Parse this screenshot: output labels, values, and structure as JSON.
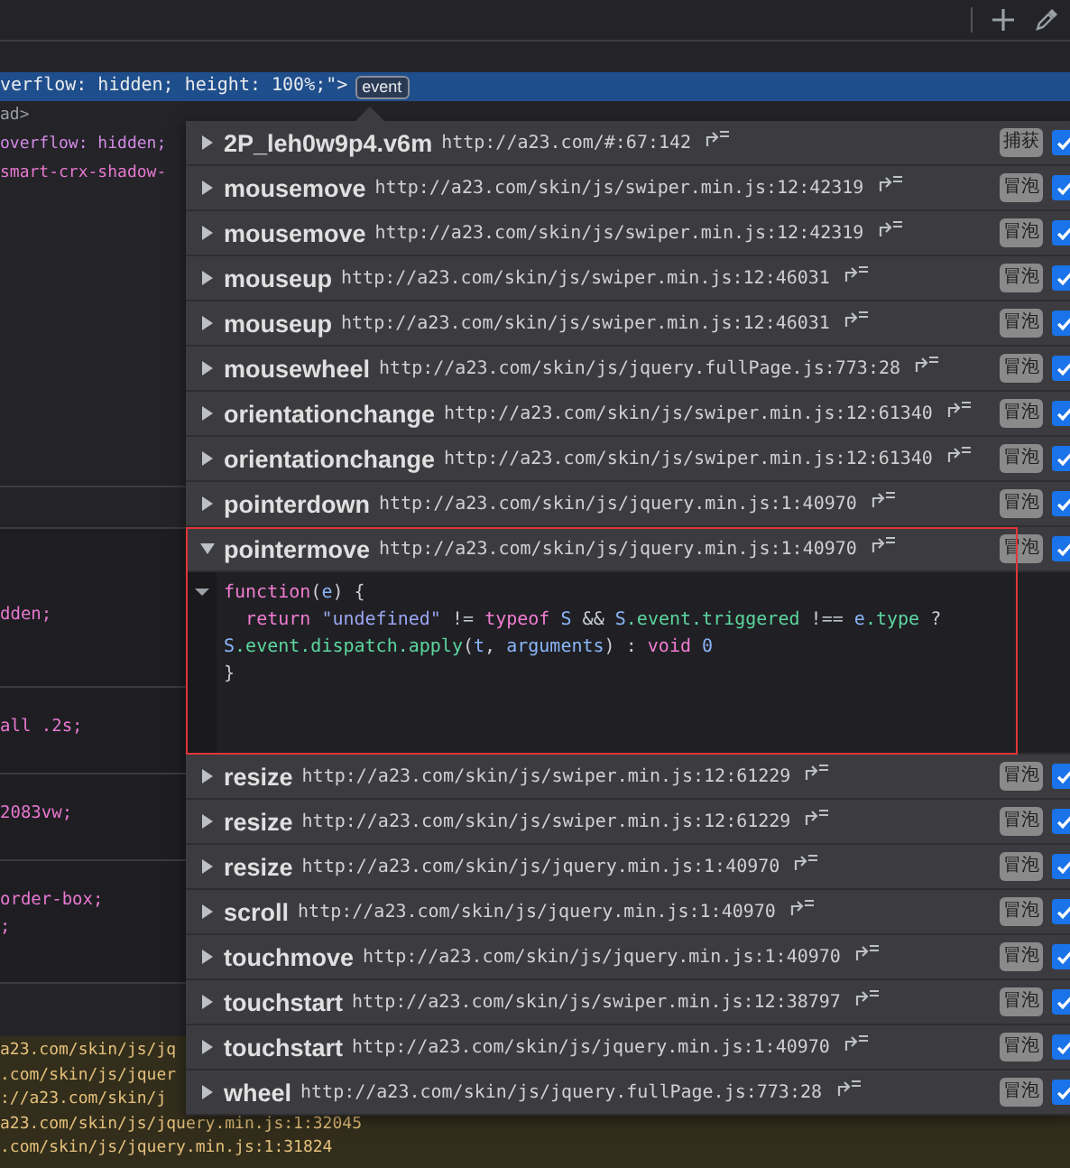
{
  "elements_panel": {
    "lines": [
      {
        "text": "verflow: hidden; height: 100%;\">",
        "selected": true,
        "badge": "event"
      },
      {
        "text": "ad>",
        "kind": "tag",
        "selected": false
      },
      {
        "text": " overflow: hidden;",
        "kind": "attribute",
        "selected": false
      },
      {
        "text": "smart-crx-shadow-",
        "kind": "value",
        "selected": false
      }
    ]
  },
  "styles_panel": {
    "rules": [
      {
        "lines": [
          "dden;"
        ]
      },
      {
        "lines": [
          "all .2s;"
        ]
      },
      {
        "lines": [
          "2083vw;"
        ]
      },
      {
        "lines": [
          "order-box;",
          ";"
        ]
      }
    ]
  },
  "console": {
    "lines": [
      "a23.com/skin/js/jq",
      ".com/skin/js/jquer",
      "://a23.com/skin/j",
      "a23.com/skin/js/jquery.min.js:1:32045",
      ".com/skin/js/jquery.min.js:1:31824"
    ]
  },
  "event_popup": {
    "listeners": [
      {
        "name": "2P_leh0w9p4.v6m",
        "url": "http://a23.com/#:67:142",
        "phase": "捕获",
        "checked": true,
        "expanded": false
      },
      {
        "name": "mousemove",
        "url": "http://a23.com/skin/js/swiper.min.js:12:42319",
        "phase": "冒泡",
        "checked": true,
        "expanded": false
      },
      {
        "name": "mousemove",
        "url": "http://a23.com/skin/js/swiper.min.js:12:42319",
        "phase": "冒泡",
        "checked": true,
        "expanded": false
      },
      {
        "name": "mouseup",
        "url": "http://a23.com/skin/js/swiper.min.js:12:46031",
        "phase": "冒泡",
        "checked": true,
        "expanded": false
      },
      {
        "name": "mouseup",
        "url": "http://a23.com/skin/js/swiper.min.js:12:46031",
        "phase": "冒泡",
        "checked": true,
        "expanded": false
      },
      {
        "name": "mousewheel",
        "url": "http://a23.com/skin/js/jquery.fullPage.js:773:28",
        "phase": "冒泡",
        "checked": true,
        "expanded": false
      },
      {
        "name": "orientationchange",
        "url": "http://a23.com/skin/js/swiper.min.js:12:61340",
        "phase": "冒泡",
        "checked": true,
        "expanded": false
      },
      {
        "name": "orientationchange",
        "url": "http://a23.com/skin/js/swiper.min.js:12:61340",
        "phase": "冒泡",
        "checked": true,
        "expanded": false
      },
      {
        "name": "pointerdown",
        "url": "http://a23.com/skin/js/jquery.min.js:1:40970",
        "phase": "冒泡",
        "checked": true,
        "expanded": false
      },
      {
        "name": "pointermove",
        "url": "http://a23.com/skin/js/jquery.min.js:1:40970",
        "phase": "冒泡",
        "checked": true,
        "expanded": true,
        "source": [
          "function(e) {",
          "  return \"undefined\" != typeof S && S.event.triggered !== e.type ?",
          "S.event.dispatch.apply(t, arguments) : void 0",
          "}"
        ]
      },
      {
        "name": "resize",
        "url": "http://a23.com/skin/js/swiper.min.js:12:61229",
        "phase": "冒泡",
        "checked": true,
        "expanded": false
      },
      {
        "name": "resize",
        "url": "http://a23.com/skin/js/swiper.min.js:12:61229",
        "phase": "冒泡",
        "checked": true,
        "expanded": false
      },
      {
        "name": "resize",
        "url": "http://a23.com/skin/js/jquery.min.js:1:40970",
        "phase": "冒泡",
        "checked": true,
        "expanded": false
      },
      {
        "name": "scroll",
        "url": "http://a23.com/skin/js/jquery.min.js:1:40970",
        "phase": "冒泡",
        "checked": true,
        "expanded": false
      },
      {
        "name": "touchmove",
        "url": "http://a23.com/skin/js/jquery.min.js:1:40970",
        "phase": "冒泡",
        "checked": true,
        "expanded": false
      },
      {
        "name": "touchstart",
        "url": "http://a23.com/skin/js/swiper.min.js:12:38797",
        "phase": "冒泡",
        "checked": true,
        "expanded": false
      },
      {
        "name": "touchstart",
        "url": "http://a23.com/skin/js/jquery.min.js:1:40970",
        "phase": "冒泡",
        "checked": true,
        "expanded": false
      },
      {
        "name": "wheel",
        "url": "http://a23.com/skin/js/jquery.fullPage.js:773:28",
        "phase": "冒泡",
        "checked": true,
        "expanded": false
      }
    ]
  }
}
